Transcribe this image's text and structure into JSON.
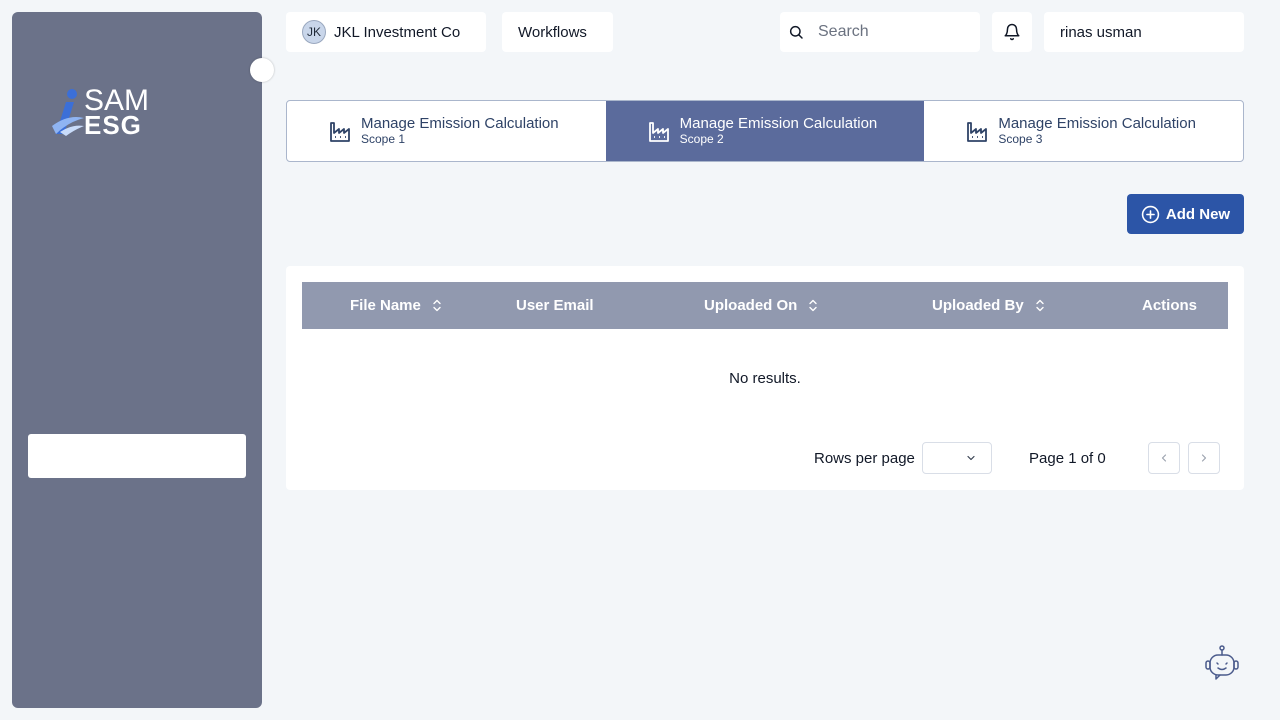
{
  "brand": {
    "logo_top": "SAM",
    "logo_bottom": "ESG"
  },
  "header": {
    "org_initials": "JK",
    "org_name": "JKL Investment Co",
    "workflows_label": "Workflows",
    "search_placeholder": "Search",
    "search_value": "",
    "user_name": "rinas usman"
  },
  "tabs": [
    {
      "title": "Manage Emission Calculation",
      "subtitle": "Scope 1",
      "active": false
    },
    {
      "title": "Manage Emission Calculation",
      "subtitle": "Scope 2",
      "active": true
    },
    {
      "title": "Manage Emission Calculation",
      "subtitle": "Scope 3",
      "active": false
    }
  ],
  "actions": {
    "add_new_label": "Add New"
  },
  "table": {
    "columns": [
      "File Name",
      "User Email",
      "Uploaded On",
      "Uploaded By",
      "Actions"
    ],
    "sortable": [
      true,
      false,
      true,
      true,
      false
    ],
    "empty_text": "No results."
  },
  "pagination": {
    "rows_per_page_label": "Rows per page",
    "rows_per_page_value": "",
    "page_info": "Page 1 of 0"
  },
  "colors": {
    "sidebar": "#6b7289",
    "active_tab": "#5b6b9c",
    "primary_button": "#2c55a7",
    "table_header": "#9199af",
    "background": "#f3f6f9"
  },
  "icons": {
    "search": "search-icon",
    "bell": "bell-icon",
    "factory": "factory-icon",
    "add": "plus-circle-icon",
    "sort": "sort-icon",
    "chevron_down": "chevron-down-icon",
    "prev": "chevron-left-icon",
    "next": "chevron-right-icon",
    "assistant": "robot-icon"
  }
}
